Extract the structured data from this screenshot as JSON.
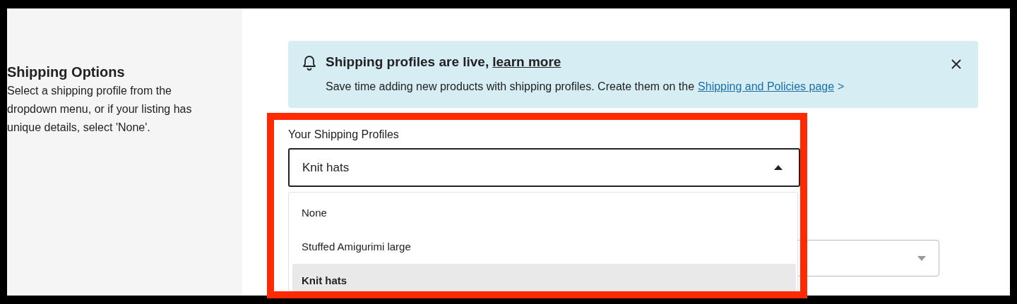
{
  "sidebar": {
    "heading": "Shipping Options",
    "description": "Select a shipping profile from the dropdown menu, or if your listing has unique details, select 'None'."
  },
  "banner": {
    "title": "Shipping profiles are live,",
    "title_link": "learn more",
    "text": "Save time adding new products with shipping profiles. Create them on the",
    "text_link": "Shipping and Policies page",
    "link_arrow": ">",
    "dismissible": true
  },
  "profile_select": {
    "label": "Your Shipping Profiles",
    "value": "Knit hats",
    "expanded": true,
    "options": [
      {
        "label": "None",
        "selected": false
      },
      {
        "label": "Stuffed Amigurimi large",
        "selected": false
      },
      {
        "label": "Knit hats",
        "selected": true
      }
    ]
  },
  "second_field": {
    "kind": "dropdown"
  },
  "annotation": {
    "kind": "highlight-frame"
  }
}
